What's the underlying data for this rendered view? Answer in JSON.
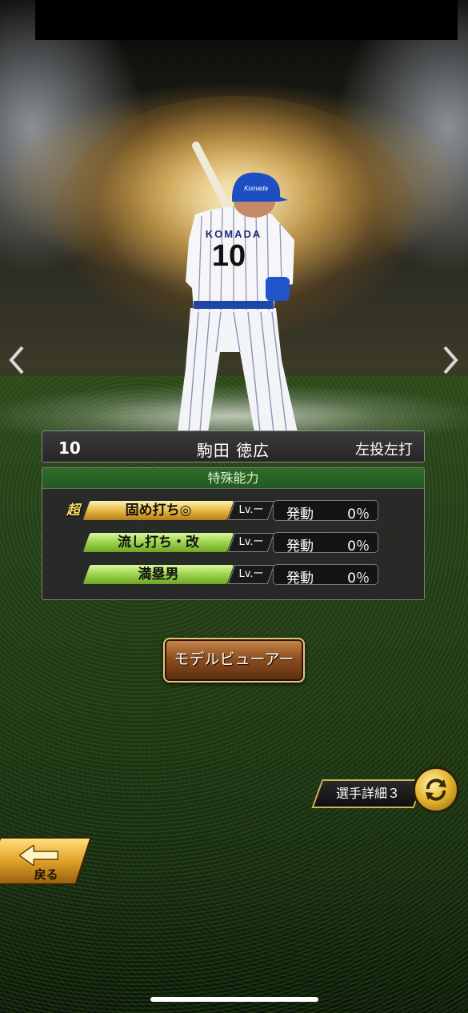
{
  "player": {
    "number": "10",
    "name": "駒田 徳広",
    "handedness": "左投左打",
    "jersey_name": "KOMADA",
    "jersey_number": "10",
    "helmet_text": "Komada"
  },
  "abilities": {
    "header": "特殊能力",
    "super_badge": "超",
    "rate_label": "発動",
    "items": [
      {
        "name": "固め打ち◎",
        "level": "Lv.ー",
        "rate": "0％",
        "tier": "super"
      },
      {
        "name": "流し打ち・改",
        "level": "Lv.ー",
        "rate": "0％",
        "tier": "normal"
      },
      {
        "name": "満塁男",
        "level": "Lv.ー",
        "rate": "0％",
        "tier": "normal"
      }
    ]
  },
  "buttons": {
    "model_viewer": "モデルビューアー",
    "player_detail": "選手詳細３",
    "back": "戻る"
  },
  "colors": {
    "ability_header": "#2f6b2a",
    "gold_tag": "#e7b944",
    "green_tag": "#9ed24c",
    "button_brown": "#8e4f1f"
  }
}
